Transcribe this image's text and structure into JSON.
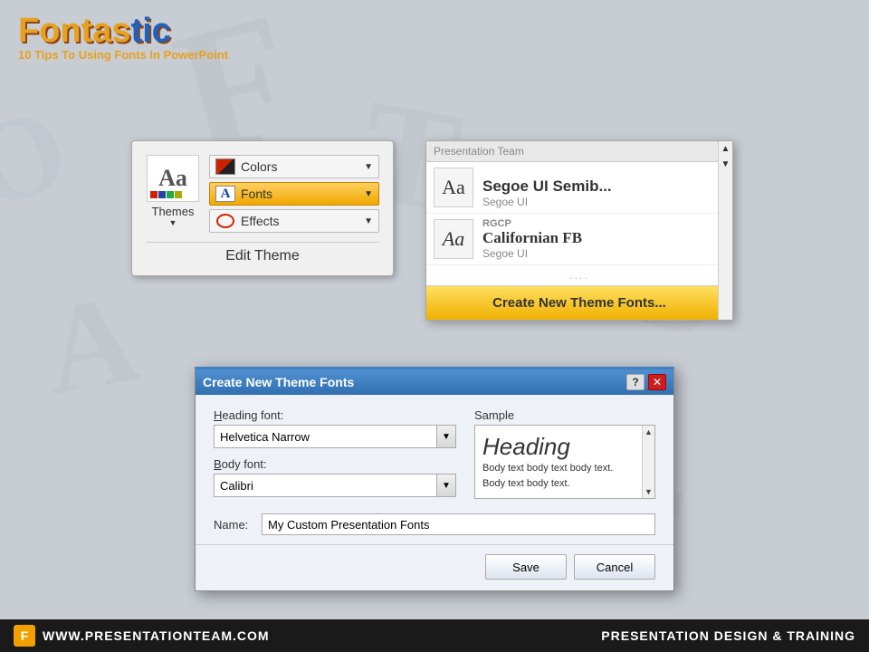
{
  "logo": {
    "title_part1": "Fontas",
    "title_part2": "tic",
    "subtitle": "10 Tips To Using Fonts In PowerPoint"
  },
  "edit_theme": {
    "title": "Edit Theme",
    "themes_label": "Themes",
    "buttons": [
      {
        "id": "colors",
        "label": "Colors",
        "active": false
      },
      {
        "id": "fonts",
        "label": "Fonts",
        "active": true
      },
      {
        "id": "effects",
        "label": "Effects",
        "active": false
      }
    ]
  },
  "font_dropdown": {
    "header": "Presentation Team",
    "items": [
      {
        "tag": "",
        "name": "Segoe UI Semib...",
        "sub": "Segoe UI"
      },
      {
        "tag": "RGCP",
        "name": "Californian FB",
        "sub": "Segoe UI"
      }
    ],
    "dots": "....",
    "create_btn_label": "Create New Theme Fonts..."
  },
  "dialog": {
    "title": "Create New Theme Fonts",
    "heading_font_label": "Heading font:",
    "heading_font_value": "Helvetica Narrow",
    "body_font_label": "Body font:",
    "body_font_value": "Calibri",
    "sample_label": "Sample",
    "sample_heading": "Heading",
    "sample_body_line1": "Body text body text body text.",
    "sample_body_line2": "Body text body text.",
    "name_label": "Name:",
    "name_value": "My Custom Presentation Fonts",
    "save_btn": "Save",
    "cancel_btn": "Cancel",
    "help_btn": "?",
    "close_btn": "✕"
  },
  "footer": {
    "icon_char": "F",
    "url": "WWW.PRESENTATIONTEAM.COM",
    "tagline": "PRESENTATION DESIGN & TRAINING"
  }
}
